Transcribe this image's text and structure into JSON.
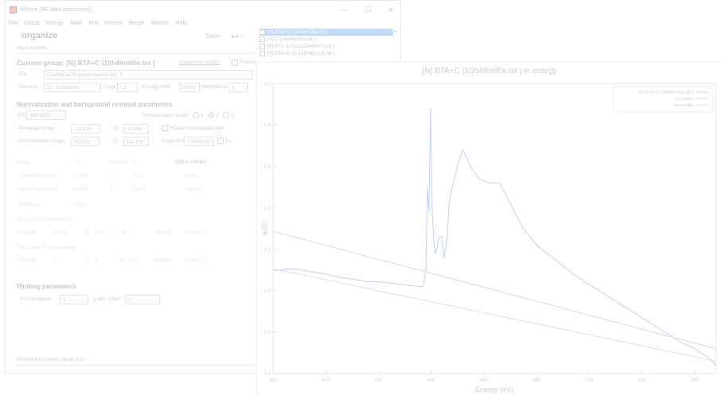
{
  "window": {
    "title": "Athena [ME data processing]",
    "controls": {
      "minimize": "—",
      "maximize": "☐",
      "close": "✕"
    }
  },
  "menu": [
    "File",
    "Group",
    "Energy",
    "Mark",
    "Plot",
    "Freeze",
    "Merge",
    "Monitor",
    "Help"
  ],
  "header": {
    "title": "organize",
    "save": "Save",
    "arrows": "◂  ▸  ›"
  },
  "main_window_label": "Main window",
  "current_group": {
    "title": "Current group:  [N] BTA+C (10h49m00s.txt )",
    "link": "Document section",
    "freeze_label": "Freeze"
  },
  "file": {
    "label": "File",
    "value": "C:\\Athena-Project\\organize.prj, 7"
  },
  "element": {
    "label": "Element",
    "value": "21: Scandium",
    "edge_label": "Edge",
    "edge_value": "L3",
    "shift_label": "Energy shift",
    "shift_value": "0.000",
    "importance_label": "Importance",
    "importance_value": "1"
  },
  "normalization": {
    "title": "Normalization and background removal parameters",
    "e0_label": "E0",
    "e0_value": "398.6527",
    "order_label": "Normalization order",
    "order_options": [
      "1",
      "2",
      "3"
    ],
    "pre_label": "Pre-edge range",
    "pre_from": "-23.426",
    "to_label": "to",
    "pre_to": "-5.464",
    "flatten_label": "Flatten normalized data",
    "norm_label": "Normalization range",
    "norm_from": "41.016",
    "norm_to": "111.140",
    "step_label": "Edge step",
    "step_value": "0.0654735",
    "fix_label": "fix"
  },
  "ghost_rows": [
    [
      "Rbkg",
      "1.0",
      "k-weight",
      "2",
      "Spline clamps"
    ],
    [
      "Spline range in k",
      "0.000",
      "to",
      "13.5",
      "None"
    ],
    [
      "Spline range in E",
      "0.000",
      "to",
      "689.3",
      "Strong"
    ],
    [
      "Standard",
      "None",
      "",
      "",
      ""
    ],
    [
      "Forward FT parameters",
      "",
      "",
      "",
      ""
    ],
    [
      "k-range",
      "2.000",
      "to",
      "13.5",
      "dk",
      "1",
      "window",
      "Hanning"
    ],
    [
      "Backward FT parameters",
      "",
      "",
      "",
      ""
    ],
    [
      "R-range",
      "1",
      "to",
      "3",
      "dr",
      "0.0",
      "window",
      "Hanning"
    ]
  ],
  "plotting": {
    "title": "Plotting parameters",
    "mult_label": "Plot multiplier",
    "mult_value": "1",
    "offset_label": "y-axis offset",
    "offset_value": "0"
  },
  "status": "Plotted the current group in E",
  "groups": [
    {
      "label": "[N] BTA+C (10h49m00s.txt )",
      "selected": true
    },
    {
      "label": "[N] C (14h46m00s.txt )",
      "selected": false
    },
    {
      "label": "[N] BTA on Cu (11h44m47s.txt )",
      "selected": false
    },
    {
      "label": "[N] BTA on Cu (13h48m12s.txt )",
      "selected": false
    }
  ],
  "plot": {
    "title": "[N] BTA+C (10h49m00s.txt ) in energy",
    "xlabel": "Energy   (eV)",
    "ylabel": "xμ(E)"
  },
  "chart_data": {
    "type": "line",
    "title": "[N] BTA+C (10h49m00s.txt ) in energy",
    "xlabel": "Energy   (eV)",
    "ylabel": "xμ(E)",
    "xlim": [
      380,
      548
    ],
    "ylim": [
      0.8,
      1.5
    ],
    "xticks": [
      380,
      400,
      420,
      440,
      460,
      480,
      500,
      520,
      540
    ],
    "yticks": [
      0.8,
      0.9,
      1.0,
      1.1,
      1.2,
      1.3,
      1.4,
      1.5
    ],
    "grid": false,
    "legend_position": "top-right",
    "series": [
      {
        "name": "[N] BTA+C (10h49m00s.txt )",
        "color": "#c3d0ef",
        "x": [
          380,
          385,
          390,
          395,
          400,
          405,
          410,
          415,
          420,
          425,
          430,
          434,
          437,
          438,
          438.6,
          439.2,
          439.8,
          440.4,
          441,
          441.6,
          442.2,
          443,
          444,
          445,
          446,
          447,
          448,
          450,
          452,
          455,
          458,
          462,
          466,
          470,
          475,
          480,
          485,
          490,
          495,
          500,
          505,
          510,
          515,
          520,
          525,
          530,
          535,
          540,
          545,
          548
        ],
        "y": [
          1.048,
          1.052,
          1.051,
          1.045,
          1.04,
          1.032,
          1.028,
          1.023,
          1.021,
          1.018,
          1.014,
          1.011,
          1.01,
          1.05,
          1.25,
          1.19,
          1.44,
          1.2,
          1.12,
          1.09,
          1.1,
          1.13,
          1.13,
          1.08,
          1.12,
          1.22,
          1.25,
          1.3,
          1.34,
          1.3,
          1.27,
          1.26,
          1.26,
          1.21,
          1.15,
          1.11,
          1.085,
          1.06,
          1.035,
          1.015,
          0.995,
          0.975,
          0.955,
          0.935,
          0.915,
          0.895,
          0.875,
          0.86,
          0.84,
          0.82
        ]
      },
      {
        "name": "pre-edge",
        "color": "#d2daf2",
        "x": [
          380,
          548
        ],
        "y": [
          1.143,
          0.86
        ]
      },
      {
        "name": "post-edge",
        "color": "#d8def3",
        "x": [
          380,
          548
        ],
        "y": [
          1.053,
          0.83
        ]
      }
    ]
  }
}
